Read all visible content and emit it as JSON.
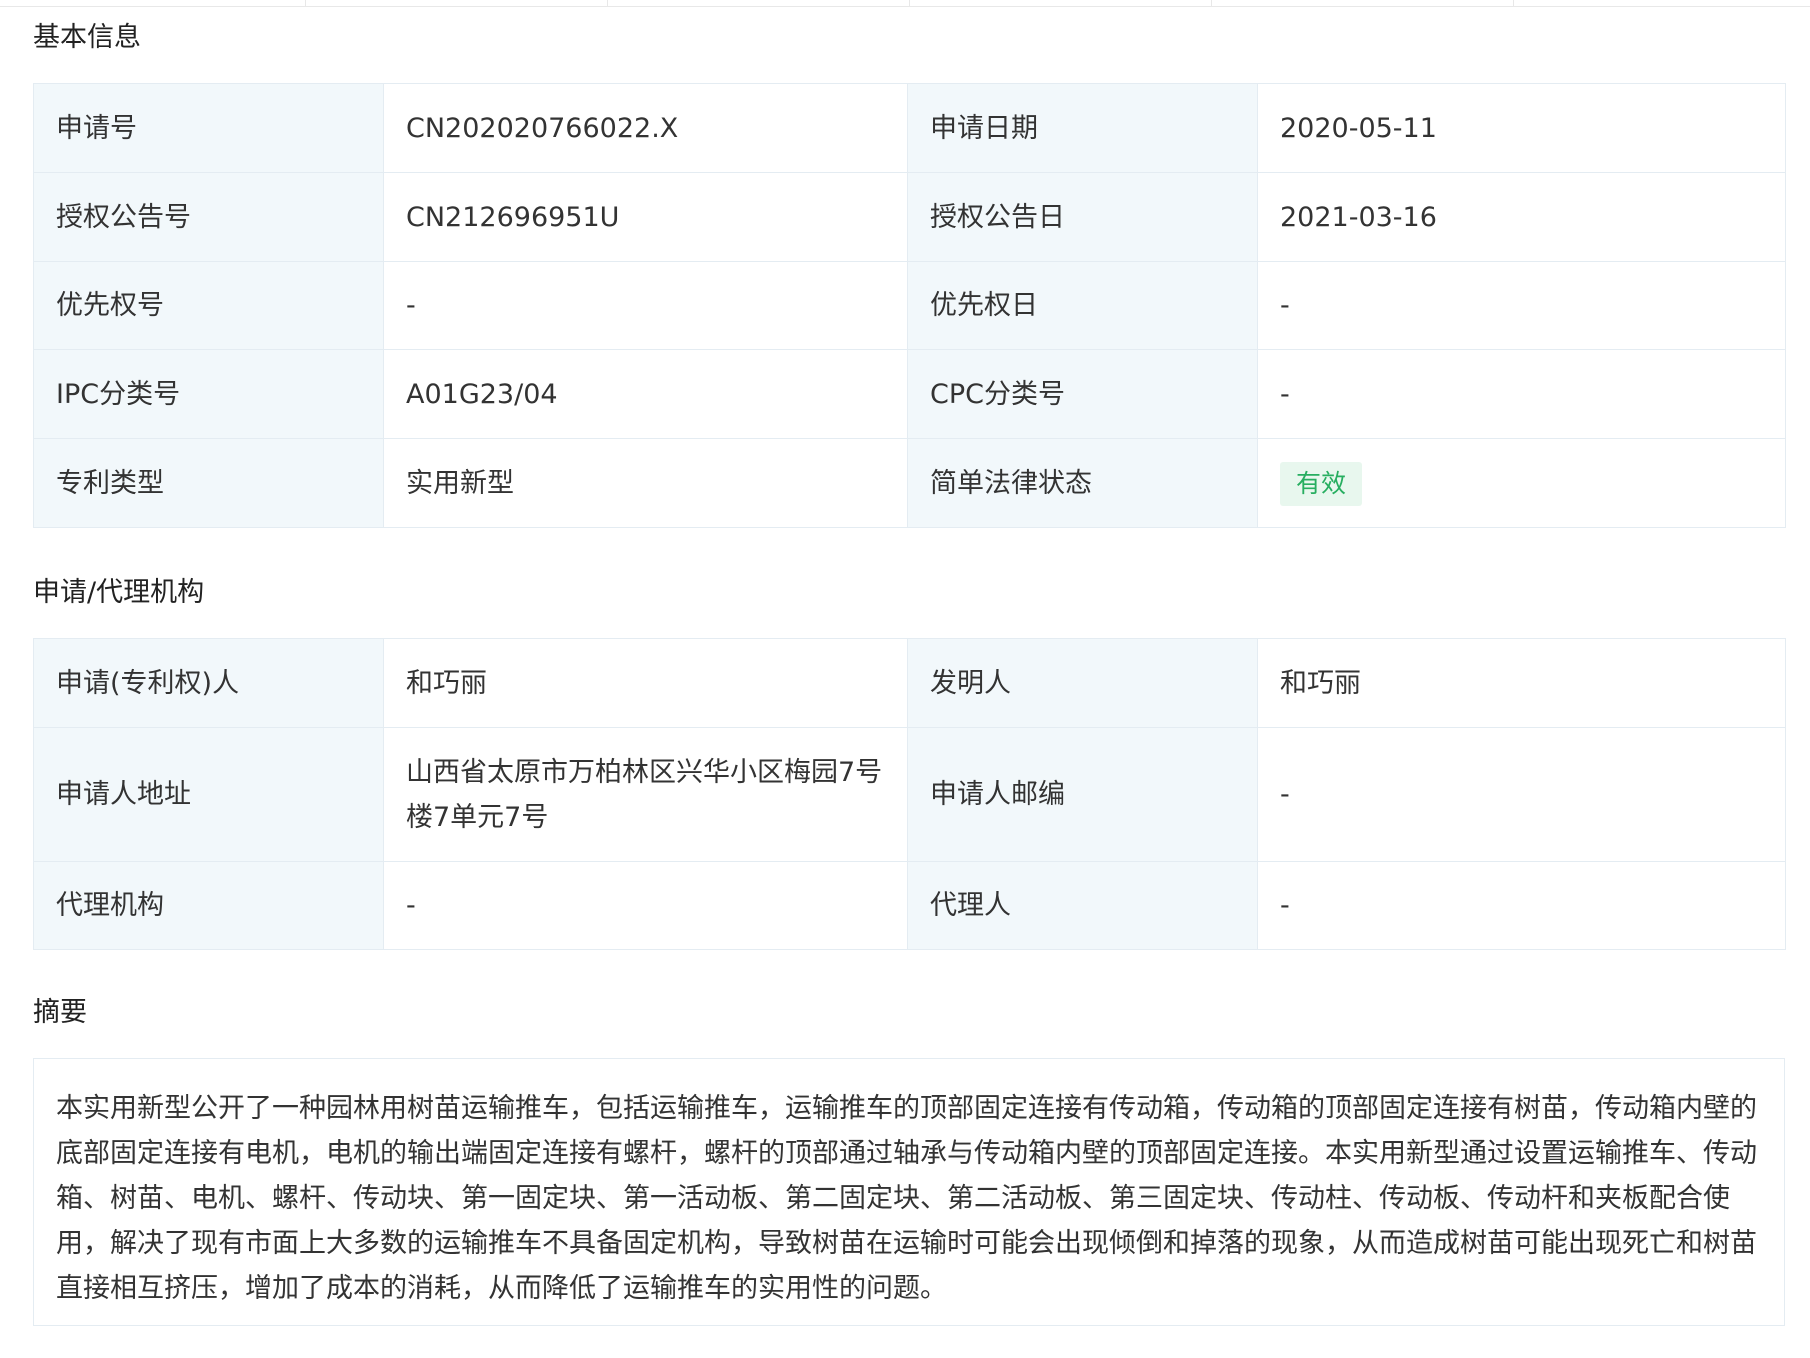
{
  "sections": {
    "basic_info_title": "基本信息",
    "agency_title": "申请/代理机构",
    "abstract_title": "摘要"
  },
  "basic_info": {
    "application_no_label": "申请号",
    "application_no": "CN202020766022.X",
    "application_date_label": "申请日期",
    "application_date": "2020-05-11",
    "grant_pub_no_label": "授权公告号",
    "grant_pub_no": "CN212696951U",
    "grant_pub_date_label": "授权公告日",
    "grant_pub_date": "2021-03-16",
    "priority_no_label": "优先权号",
    "priority_no": "-",
    "priority_date_label": "优先权日",
    "priority_date": "-",
    "ipc_label": "IPC分类号",
    "ipc": "A01G23/04",
    "cpc_label": "CPC分类号",
    "cpc": "-",
    "patent_type_label": "专利类型",
    "patent_type": "实用新型",
    "legal_status_label": "简单法律状态",
    "legal_status": "有效"
  },
  "agency": {
    "applicant_label": "申请(专利权)人",
    "applicant": "和巧丽",
    "inventor_label": "发明人",
    "inventor": "和巧丽",
    "applicant_address_label": "申请人地址",
    "applicant_address": "山西省太原市万柏林区兴华小区梅园7号楼7单元7号",
    "applicant_postcode_label": "申请人邮编",
    "applicant_postcode": "-",
    "agency_label": "代理机构",
    "agency": "-",
    "agent_label": "代理人",
    "agent": "-"
  },
  "abstract": {
    "text": "本实用新型公开了一种园林用树苗运输推车，包括运输推车，运输推车的顶部固定连接有传动箱，传动箱的顶部固定连接有树苗，传动箱内壁的底部固定连接有电机，电机的输出端固定连接有螺杆，螺杆的顶部通过轴承与传动箱内壁的顶部固定连接。本实用新型通过设置运输推车、传动箱、树苗、电机、螺杆、传动块、第一固定块、第一活动板、第二固定块、第二活动板、第三固定块、传动柱、传动板、传动杆和夹板配合使用，解决了现有市面上大多数的运输推车不具备固定机构，导致树苗在运输时可能会出现倾倒和掉落的现象，从而造成树苗可能出现死亡和树苗直接相互挤压，增加了成本的消耗，从而降低了运输推车的实用性的问题。"
  },
  "colors": {
    "label_bg": "#f2f8fb",
    "border": "#e4ecf2",
    "status_bg": "#e8f7ee",
    "status_text": "#27ae60"
  }
}
